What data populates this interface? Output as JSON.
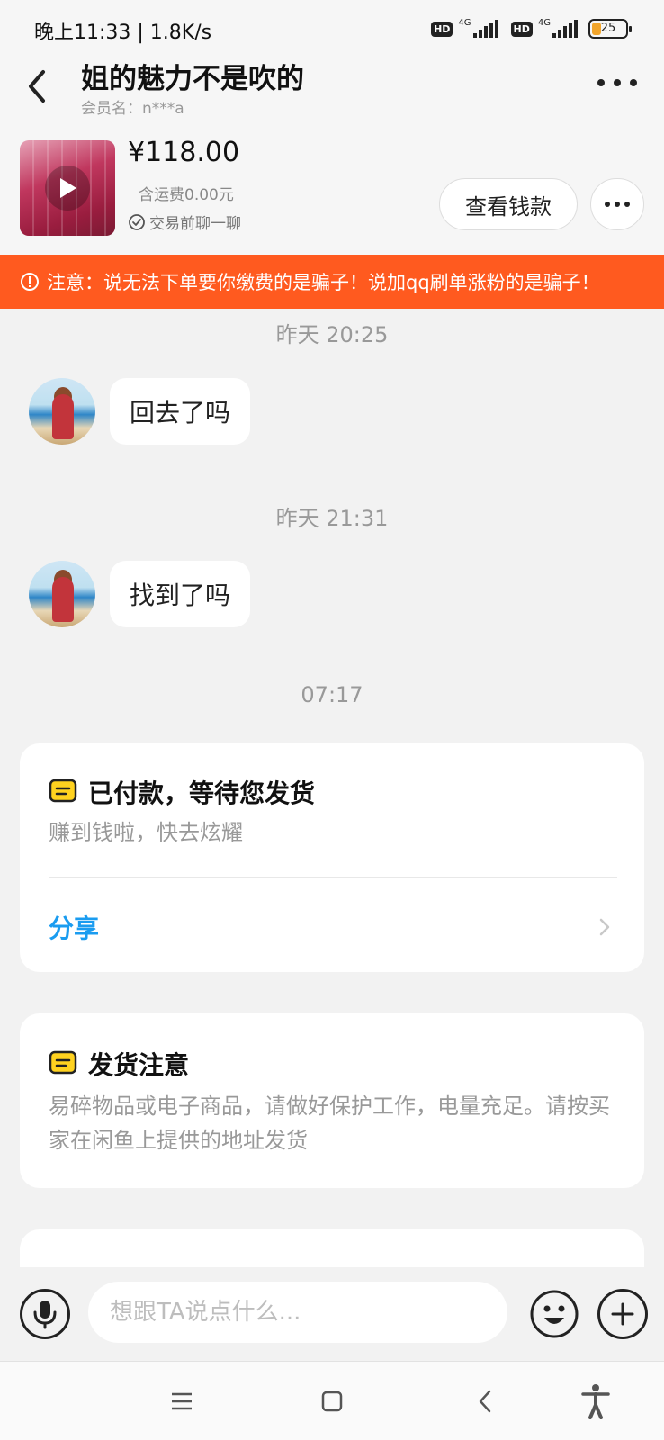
{
  "status_bar": {
    "left_text": "晚上11:33 | 1.8K/s",
    "sim1_badge": "HD",
    "sim1_network": "4G",
    "sim2_badge": "HD",
    "sim2_network": "4G",
    "battery_level": "25"
  },
  "header": {
    "title": "姐的魅力不是吹的",
    "member_label": "会员名：n***a"
  },
  "product": {
    "price": "¥118.00",
    "shipping": "含运费0.00元",
    "chat_hint": "交易前聊一聊",
    "view_payment_button": "查看钱款"
  },
  "warning_banner": {
    "text": "注意：说无法下单要你缴费的是骗子！说加qq刷单涨粉的是骗子！",
    "color": "#ff5a1f"
  },
  "messages": [
    {
      "timestamp": "昨天 20:25",
      "text": "回去了吗"
    },
    {
      "timestamp": "昨天 21:31",
      "text": "找到了吗"
    }
  ],
  "system_timestamp": "07:17",
  "cards": [
    {
      "icon": "receipt-icon",
      "title": "已付款，等待您发货",
      "description": "赚到钱啦，快去炫耀",
      "action_label": "分享",
      "action_color": "#1a9cf0"
    },
    {
      "icon": "receipt-icon",
      "title": "发货注意",
      "description": "易碎物品或电子商品，请做好保护工作，电量充足。请按买家在闲鱼上提供的地址发货"
    }
  ],
  "input_bar": {
    "placeholder": "想跟TA说点什么...",
    "value": ""
  },
  "icons": {
    "back": "back-arrow-icon",
    "more": "more-dots-icon",
    "play": "play-icon",
    "check": "check-circle-icon",
    "warning": "warning-circle-icon",
    "mic": "microphone-icon",
    "emoji": "emoji-icon",
    "plus": "plus-icon",
    "menu": "menu-icon",
    "home": "home-square-icon",
    "nav_back": "nav-back-icon",
    "accessibility": "accessibility-icon"
  }
}
